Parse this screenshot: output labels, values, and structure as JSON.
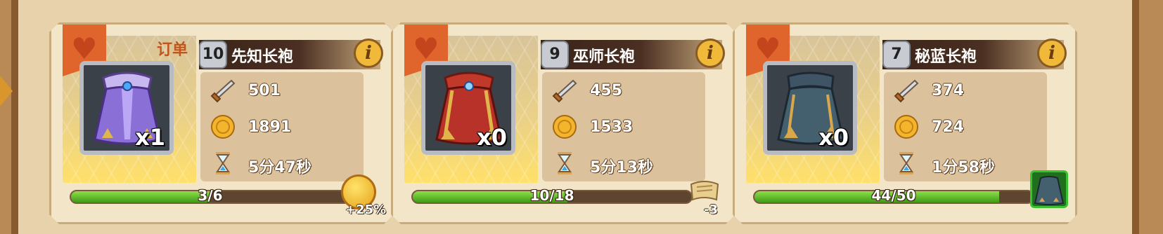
{
  "colors": {
    "panel_bg": "#e7d2ac",
    "card_bg": "#f3e6c8",
    "banner": "#e0652c",
    "progress_green": "#3f9b16",
    "title_dark": "#3a2418"
  },
  "cards": [
    {
      "order_label": "订单",
      "level": "10",
      "name": "先知长袍",
      "count": "x1",
      "attack": "501",
      "gold": "1891",
      "time": "5分47秒",
      "progress_text": "3/6",
      "progress_fraction": 0.5,
      "bonus": "+25%",
      "item_icon": "purple-robe-icon"
    },
    {
      "level": "9",
      "name": "巫师长袍",
      "count": "x0",
      "attack": "455",
      "gold": "1533",
      "time": "5分13秒",
      "progress_text": "10/18",
      "progress_fraction": 0.556,
      "bonus": "-3",
      "item_icon": "red-robe-icon"
    },
    {
      "level": "7",
      "name": "秘蓝长袍",
      "count": "x0",
      "attack": "374",
      "gold": "724",
      "time": "1分58秒",
      "progress_text": "44/50",
      "progress_fraction": 0.88,
      "item_icon": "blue-robe-icon"
    }
  ]
}
